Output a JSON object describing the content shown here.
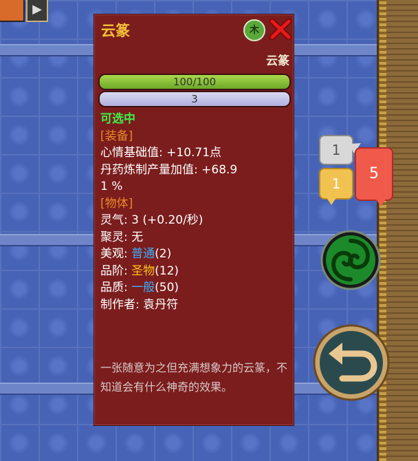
{
  "item": {
    "title": "云篆",
    "element": "木",
    "subtitle": "云篆",
    "hp_text": "100/100",
    "hp_fraction": 1.0,
    "sp_text": "3"
  },
  "lines": {
    "selectable": "可选中",
    "equip_header": "[装备]",
    "mood_label": "心情基础值: +10.71点",
    "pill_label_a": "丹药炼制产量加值: +68.9",
    "pill_label_b": "1 %",
    "object_header": "[物体]",
    "qi": "灵气: 3 (+0.20/秒)",
    "gather_label": "聚灵: ",
    "gather_value": "无",
    "beauty_label": "美观: ",
    "beauty_value": "普通",
    "beauty_num": "(2)",
    "rank_label": "品阶: ",
    "rank_value": "圣物",
    "rank_num": "(12)",
    "quality_label": "品质: ",
    "quality_value": "一般",
    "quality_num": "(50)",
    "maker_label": "制作者: ",
    "maker_value": "袁丹符"
  },
  "description": "一张随意为之但充满想象力的云篆，不知道会有什么神奇的效果。",
  "notifications": {
    "grey_count": "1",
    "yellow_count": "1",
    "red_count": "5"
  },
  "colors": {
    "panel_bg": "#7b1d1d",
    "title": "#f5c23a",
    "selectable": "#3ef04a",
    "header": "#e88a2a",
    "common": "#3ab0ff",
    "holy": "#ffc21a"
  }
}
